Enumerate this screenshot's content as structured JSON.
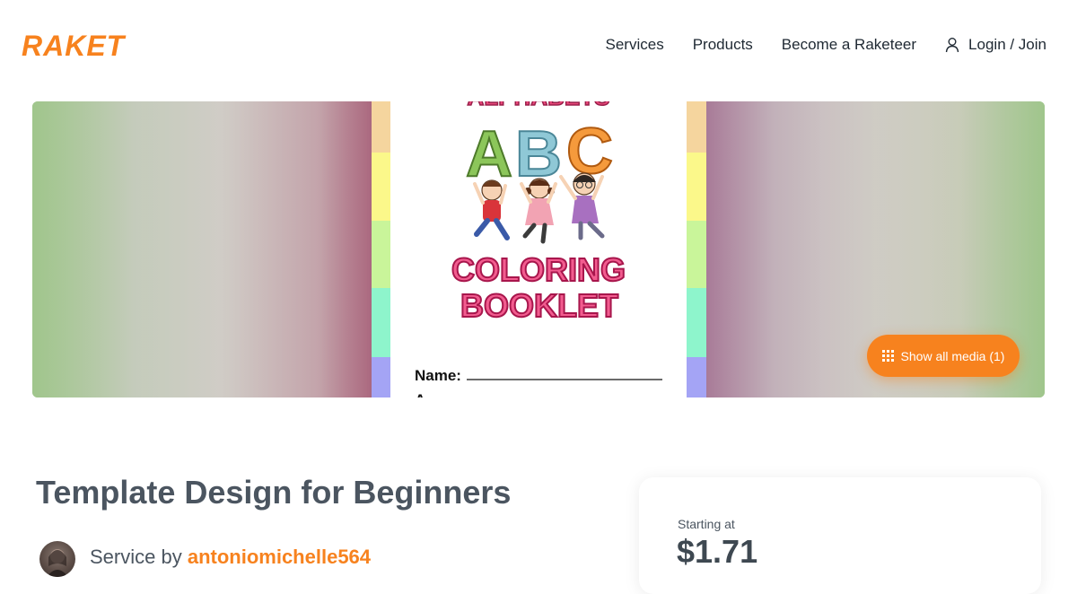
{
  "brand": {
    "name": "RAKET",
    "color": "#f7821e"
  },
  "nav": {
    "items": [
      {
        "label": "Services"
      },
      {
        "label": "Products"
      },
      {
        "label": "Become a Raketeer"
      }
    ],
    "login_label": "Login / Join",
    "login_icon": "user-icon"
  },
  "media": {
    "booklet": {
      "top_text": "ALPHABETS",
      "letters": [
        "A",
        "B",
        "C"
      ],
      "title_line1": "COLORING",
      "title_line2": "BOOKLET",
      "name_label": "Name:"
    },
    "show_all_label": "Show all media (1)",
    "show_all_icon": "grid-icon"
  },
  "service": {
    "title": "Template Design for Beginners",
    "service_by_label": "Service by",
    "author": "antoniomichelle564"
  },
  "pricing": {
    "starting_at_label": "Starting at",
    "price": "$1.71"
  }
}
